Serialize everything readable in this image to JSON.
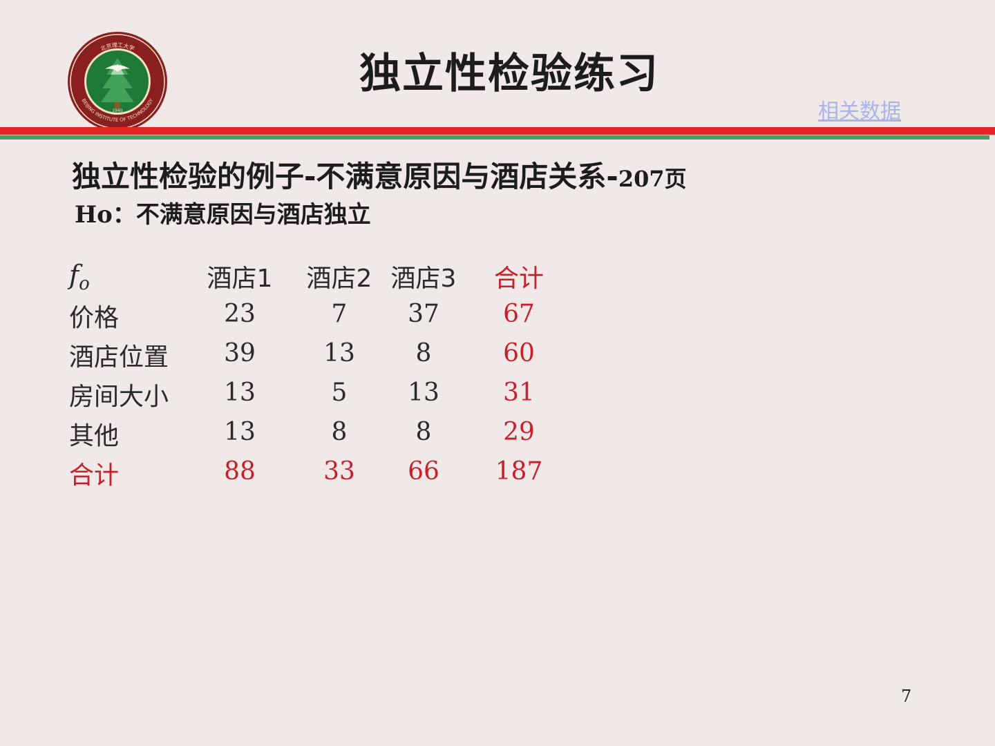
{
  "title": "独立性检验练习",
  "related_link": "相关数据",
  "logo": {
    "text_top": "北京理工大学",
    "text_bottom": "BEIJING INSTITUTE OF TECHNOLOGY",
    "year": "1940",
    "colors": {
      "ring": "#8a1f1f",
      "field": "#1f7a3a",
      "cream": "#f3e2c8"
    }
  },
  "subtitle": {
    "main": "独立性检验的例子-不满意原因与酒店关系-",
    "page_ref": "207页"
  },
  "hypothesis": {
    "prefix": "Ho",
    "separator": "：",
    "text": "不满意原因与酒店独立"
  },
  "table": {
    "corner": {
      "symbol": "f",
      "subscript": "o"
    },
    "columns": [
      "酒店1",
      "酒店2",
      "酒店3",
      "合计"
    ],
    "rows": [
      {
        "label": "价格",
        "values": [
          "23",
          "7",
          "37",
          "67"
        ]
      },
      {
        "label": "酒店位置",
        "values": [
          "39",
          "13",
          "8",
          "60"
        ]
      },
      {
        "label": "房间大小",
        "values": [
          "13",
          "5",
          "13",
          "31"
        ]
      },
      {
        "label": "其他",
        "values": [
          "13",
          "8",
          "8",
          "29"
        ]
      },
      {
        "label": "合计",
        "values": [
          "88",
          "33",
          "66",
          "187"
        ]
      }
    ]
  },
  "page_number": "7",
  "colors": {
    "background": "#f1e8e8",
    "accent_red": "#c8202a",
    "bar_red": "#e32626",
    "bar_green": "#4f9a64",
    "link": "#a9b3e6"
  }
}
